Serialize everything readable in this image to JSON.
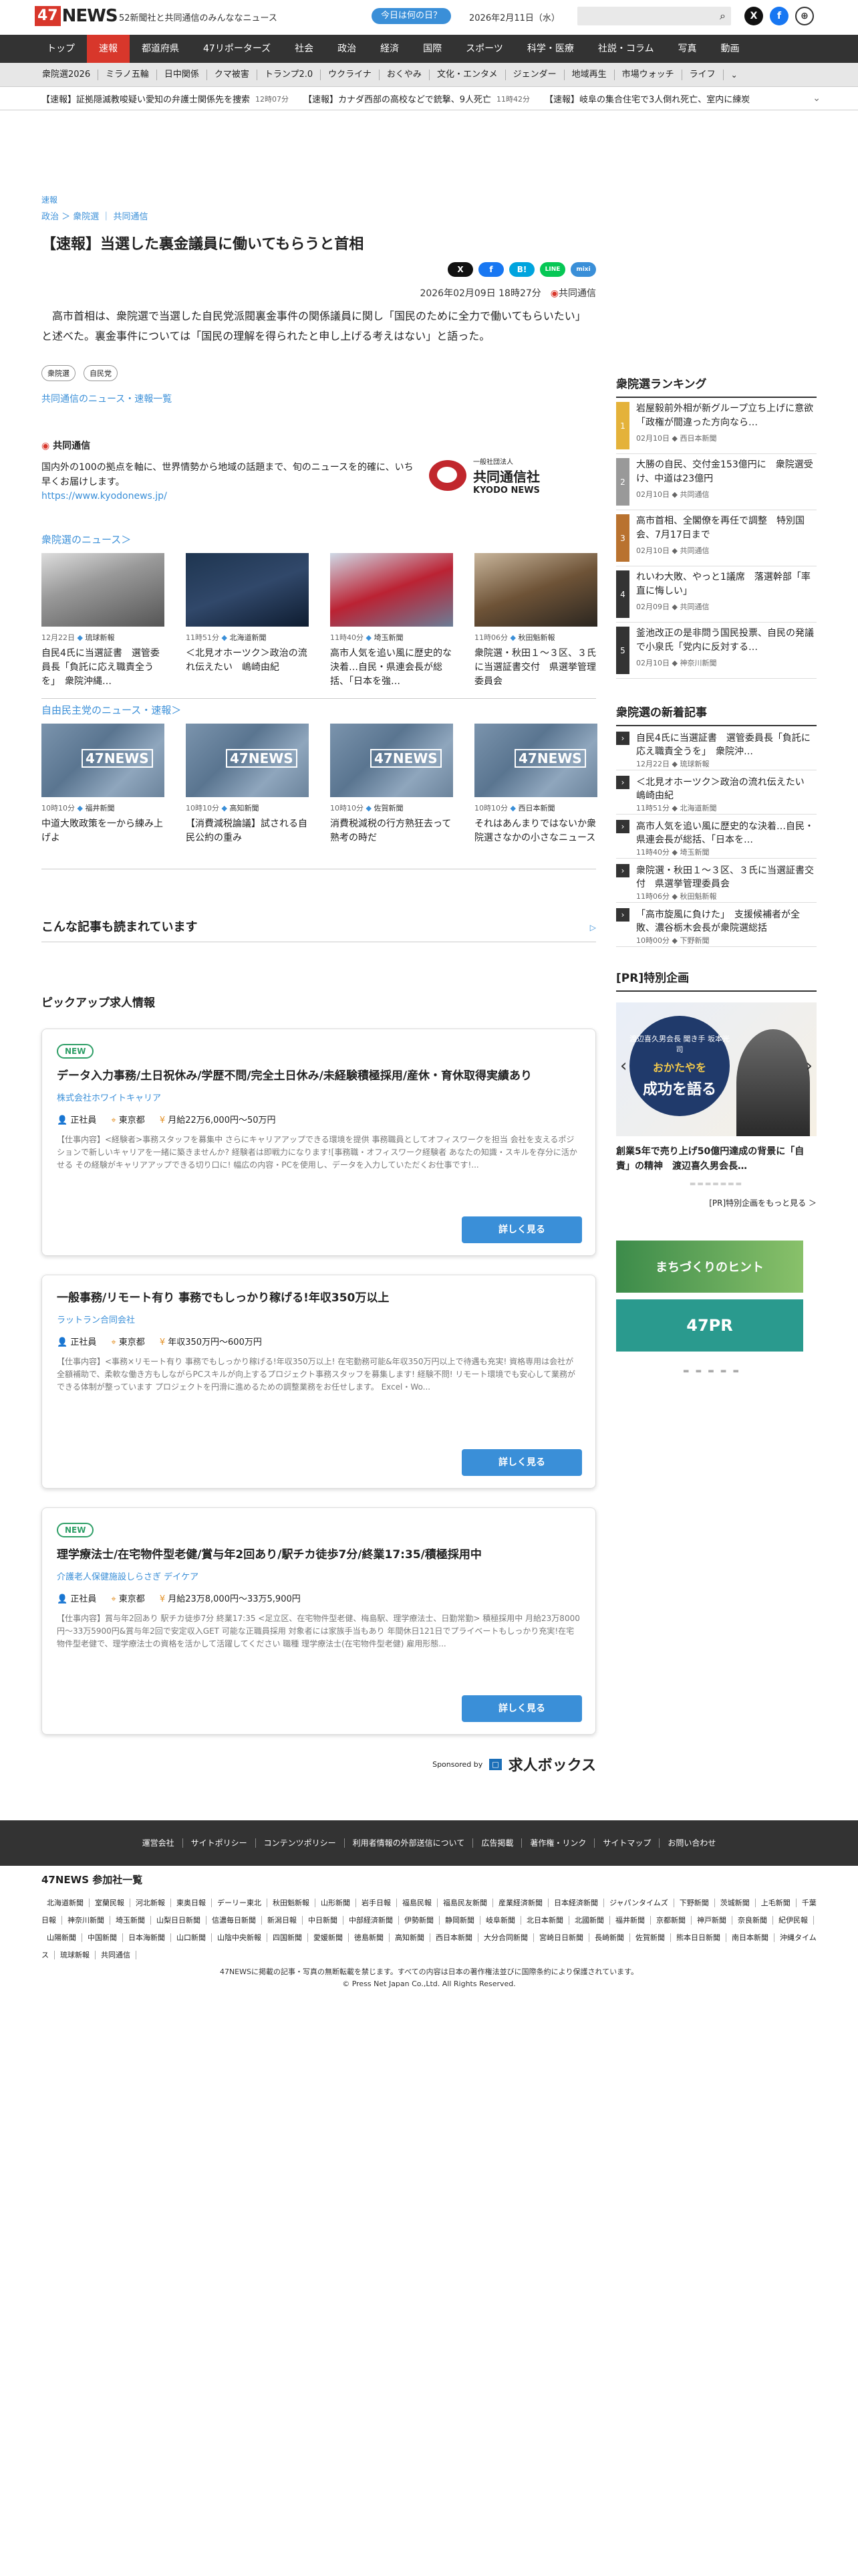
{
  "header": {
    "logo_num": "47",
    "logo_word": "NEWS",
    "tagline": "52新聞社と共同通信のみんななニュース",
    "day_button": "今日は何の日？",
    "date": "2026年2月11日（水）",
    "x_icon": "X",
    "fb_icon": "f"
  },
  "nav": [
    "トップ",
    "速報",
    "都道府県",
    "47リポーターズ",
    "社会",
    "政治",
    "経済",
    "国際",
    "スポーツ",
    "科学・医療",
    "社説・コラム",
    "写真",
    "動画"
  ],
  "subnav": [
    "衆院選2026",
    "ミラノ五輪",
    "日中関係",
    "クマ被害",
    "トランプ2.0",
    "ウクライナ",
    "おくやみ",
    "文化・エンタメ",
    "ジェンダー",
    "地域再生",
    "市場ウォッチ",
    "ライフ"
  ],
  "ticker": [
    {
      "text": "【速報】証拠隠滅教唆疑い愛知の弁護士関係先を捜索",
      "time": "12時07分"
    },
    {
      "text": "【速報】カナダ西部の高校などで銃撃、9人死亡",
      "time": "11時42分"
    },
    {
      "text": "【速報】岐阜の集合住宅で3人倒れ死亡、室内に練炭",
      "time": ""
    }
  ],
  "article": {
    "category": "速報",
    "breadcrumb": "政治 ＞ 衆院選 ｜ 共同通信",
    "title": "【速報】当選した裏金議員に働いてもらうと首相",
    "dateline": "2026年02月09日 18時27分",
    "source_label": "共同通信",
    "body": "高市首相は、衆院選で当選した自民党派閥裏金事件の関係議員に関し「国民のために全力で働いてもらいたい」と述べた。裏金事件については「国民の理解を得られたと申し上げる考えはない」と語った。",
    "tags": [
      "衆院選",
      "自民党"
    ],
    "more_link": "共同通信のニュース・速報一覧",
    "share": [
      "X",
      "f",
      "B!",
      "LINE",
      "mixi"
    ]
  },
  "source_box": {
    "name": "共同通信",
    "desc": "国内外の100の拠点を軸に、世界情勢から地域の話題まで、旬のニュースを的確に、いち早くお届けします。",
    "url": "https://www.kyodonews.jp/",
    "logo_small": "一般社団法人",
    "logo_big": "共同通信社",
    "logo_en": "KYODO NEWS"
  },
  "section1": {
    "title": "衆院選のニュース＞",
    "cards": [
      {
        "time": "12月22日",
        "src": "琉球新報",
        "title": "自民4氏に当選証書　選管委員長「負託に応え職責全うを」　衆院沖縄…"
      },
      {
        "time": "11時51分",
        "src": "北海道新聞",
        "title": "＜北見オホーツク＞政治の流れ伝えたい　嶋崎由紀"
      },
      {
        "time": "11時40分",
        "src": "埼玉新聞",
        "title": "高市人気を追い風に歴史的な決着…自民・県連会長が総括、「日本を強…"
      },
      {
        "time": "11時06分",
        "src": "秋田魁新報",
        "title": "衆院選・秋田１～３区、３氏に当選証書交付　県選挙管理委員会"
      }
    ]
  },
  "section2": {
    "title": "自由民主党のニュース・速報＞",
    "cards": [
      {
        "time": "10時10分",
        "src": "福井新聞",
        "title": "中道大敗政策を一から練み上げよ"
      },
      {
        "time": "10時10分",
        "src": "高知新聞",
        "title": "【消費減税論議】試される自民公約の重み"
      },
      {
        "time": "10時10分",
        "src": "佐賀新聞",
        "title": "消費税減税の行方熟狂去って熟考の時だ"
      },
      {
        "time": "10時10分",
        "src": "西日本新聞",
        "title": "それはあんまりではないか衆院選さなかの小さなニュース"
      }
    ]
  },
  "card_logo": "47NEWS",
  "also_read": "こんな記事も読まれています",
  "ad_icon": "▷",
  "pickup": {
    "title": "ピックアップ求人情報",
    "jobs": [
      {
        "new": "NEW",
        "title": "データ入力事務/土日祝休み/学歴不問/完全土日休み/未経験積極採用/産休・育休取得実績あり",
        "company": "株式会社ホワイトキャリア",
        "type": "正社員",
        "place": "東京都",
        "pay": "月給22万6,000円～50万円",
        "desc": "【仕事内容】<経験者>事務スタッフを募集中 さらにキャリアアップできる環境を提供 事務職員としてオフィスワークを担当 会社を支えるポジションで新しいキャリアを一緒に築きませんか? 経験者は即戦力になります![事務職・オフィスワーク経験者 あなたの知識・スキルを存分に活かせる その経験がキャリアアップできる切り口に! 幅広の内容・PCを使用し、データを入力していただくお仕事です!...",
        "btn": "詳しく見る"
      },
      {
        "new": "",
        "title": "一般事務/リモート有り 事務でもしっかり稼げる!年収350万以上",
        "company": "ラットラン合同会社",
        "type": "正社員",
        "place": "東京都",
        "pay": "年収350万円～600万円",
        "desc": "【仕事内容】<事務×リモート有り 事務でもしっかり稼げる!年収350万以上! 在宅勤務可能&年収350万円以上で待遇も充実! 資格専用は会社が全額補助で、柔軟な働き方もしながらPCスキルが向上するプロジェクト事務スタッフを募集します! 経験不問! リモート環境でも安心して業務ができる体制が整っています プロジェクトを円滑に進めるための調整業務をお任せします。 Excel・Wo...",
        "btn": "詳しく見る"
      },
      {
        "new": "NEW",
        "title": "理学療法士/在宅物件型老健/賞与年2回あり/駅チカ徒歩7分/終業17:35/積極採用中",
        "company": "介護老人保健施設しらさぎ デイケア",
        "type": "正社員",
        "place": "東京都",
        "pay": "月給23万8,000円～33万5,900円",
        "desc": "【仕事内容】賞与年2回あり 駅チカ徒歩7分 終業17:35 <足立区、在宅物件型老健、梅島駅、理学療法士、日勤常勤> 積極採用中 月給23万8000円～33万5900円&賞与年2回で安定収入GET 可能な正職員採用 対象者には家族手当もあり 年間休日121日でプライベートもしっかり充実!在宅物件型老健で、理学療法士の資格を活かして活躍してください 職種 理学療法士(在宅物件型老健) 雇用形態...",
        "btn": "詳しく見る"
      }
    ],
    "sponsored": "Sponsored by",
    "sponsor_name": "求人ボックス"
  },
  "sidebar": {
    "ranking_title": "衆院選ランキング",
    "ranking": [
      {
        "n": "1",
        "color": "#e4b23a",
        "title": "岩屋毅前外相が新グループ立ち上げに意欲　「政権が間違った方向なら…",
        "meta": "02月10日",
        "src": "西日本新聞"
      },
      {
        "n": "2",
        "color": "#999999",
        "title": "大勝の自民、交付金153億円に　衆院選受け、中道は23億円",
        "meta": "02月10日",
        "src": "共同通信"
      },
      {
        "n": "3",
        "color": "#b9722f",
        "title": "高市首相、全閣僚を再任で調整　特別国会、7月17日まで",
        "meta": "02月10日",
        "src": "共同通信"
      },
      {
        "n": "4",
        "color": "#333333",
        "title": "れいわ大敗、やっと1議席　落選幹部「率直に悔しい」",
        "meta": "02月09日",
        "src": "共同通信"
      },
      {
        "n": "5",
        "color": "#333333",
        "title": "釜池改正の是非問う国民投票、自民の発議で小泉氏「党内に反対する…",
        "meta": "02月10日",
        "src": "神奈川新聞"
      }
    ],
    "new_title": "衆院選の新着記事",
    "new": [
      {
        "title": "自民4氏に当選証書　選管委員長「負託に応え職責全うを」　衆院沖…",
        "meta": "12月22日",
        "src": "琉球新報"
      },
      {
        "title": "＜北見オホーツク＞政治の流れ伝えたい　嶋崎由紀",
        "meta": "11時51分",
        "src": "北海道新聞"
      },
      {
        "title": "高市人気を追い風に歴史的な決着…自民・県連会長が総括、「日本を…",
        "meta": "11時40分",
        "src": "埼玉新聞"
      },
      {
        "title": "衆院選・秋田１～３区、３氏に当選証書交付　県選挙管理委員会",
        "meta": "11時06分",
        "src": "秋田魁新報"
      },
      {
        "title": "「高市旋風に負けた」　支援候補者が全敗、濃谷栃木会長が衆院選総括",
        "meta": "10時00分",
        "src": "下野新聞"
      }
    ],
    "pr_title": "[PR]特別企画",
    "pr_banner_top": "渡辺喜久男会長 聞き手 坂本光司",
    "pr_banner_mid": "おかたやを",
    "pr_banner_big": "成功を語る",
    "pr_caption": "創業5年で売り上げ50億円達成の背景に「自責」の精神　渡辺喜久男会長…",
    "pr_more": "[PR]特別企画をもっと見る ＞",
    "banner1": "まちづくりのヒント",
    "banner2": "47PR"
  },
  "footer": {
    "links": [
      "運営会社",
      "サイトポリシー",
      "コンテンツポリシー",
      "利用者情報の外部送信について",
      "広告掲載",
      "著作権・リンク",
      "サイトマップ",
      "お問い合わせ"
    ],
    "members_title": "47NEWS 参加社一覧",
    "members": [
      "北海道新聞",
      "室蘭民報",
      "河北新報",
      "東奥日報",
      "デーリー東北",
      "秋田魁新報",
      "山形新聞",
      "岩手日報",
      "福島民報",
      "福島民友新聞",
      "産業経済新聞",
      "日本経済新聞",
      "ジャパンタイムズ",
      "下野新聞",
      "茨城新聞",
      "上毛新聞",
      "千葉日報",
      "神奈川新聞",
      "埼玉新聞",
      "山梨日日新聞",
      "信濃毎日新聞",
      "新潟日報",
      "中日新聞",
      "中部経済新聞",
      "伊勢新聞",
      "静岡新聞",
      "岐阜新聞",
      "北日本新聞",
      "北國新聞",
      "福井新聞",
      "京都新聞",
      "神戸新聞",
      "奈良新聞",
      "紀伊民報",
      "山陽新聞",
      "中国新聞",
      "日本海新聞",
      "山口新聞",
      "山陰中央新報",
      "四国新聞",
      "愛媛新聞",
      "徳島新聞",
      "高知新聞",
      "西日本新聞",
      "大分合同新聞",
      "宮崎日日新聞",
      "長崎新聞",
      "佐賀新聞",
      "熊本日日新聞",
      "南日本新聞",
      "沖縄タイムス",
      "琉球新報",
      "共同通信"
    ],
    "copy1": "47NEWSに掲載の記事・写真の無断転載を禁じます。すべての内容は日本の著作権法並びに国際条約により保護されています。",
    "copy2": "© Press Net Japan Co.,Ltd. All Rights Reserved."
  }
}
